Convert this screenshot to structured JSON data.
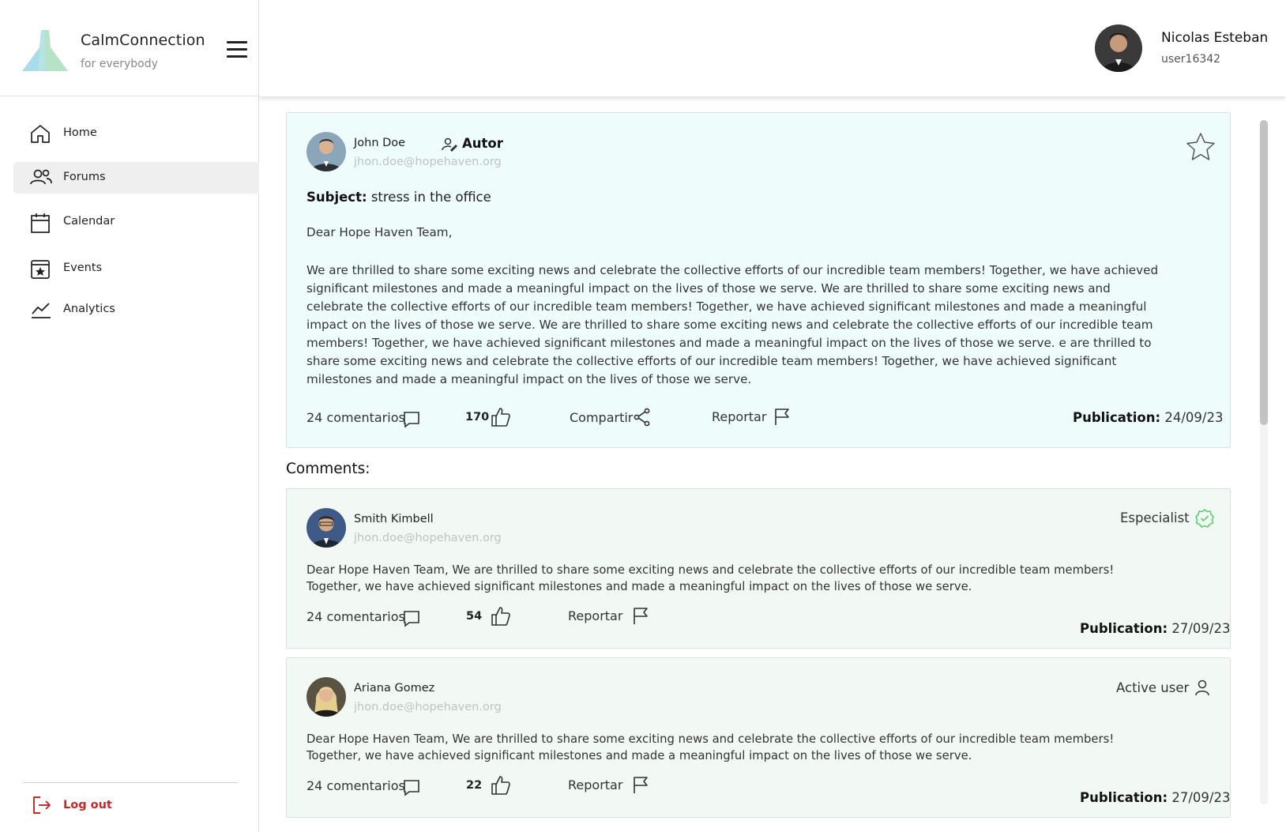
{
  "brand": {
    "name": "CalmConnection",
    "tagline": "for everybody"
  },
  "nav": {
    "items": [
      {
        "label": "Home",
        "icon": "home-icon"
      },
      {
        "label": "Forums",
        "icon": "users-icon",
        "active": true
      },
      {
        "label": "Calendar",
        "icon": "calendar-icon"
      },
      {
        "label": "Events",
        "icon": "star-calendar-icon"
      },
      {
        "label": "Analytics",
        "icon": "trend-line-icon"
      }
    ],
    "logout": "Log out"
  },
  "user": {
    "name": "Nicolas Esteban",
    "handle": "user16342"
  },
  "post": {
    "author": "John Doe",
    "role": "Autor",
    "email": "jhon.doe@hopehaven.org",
    "subject_label": "Subject:",
    "subject": "stress in the office",
    "greeting": "Dear Hope Haven Team,",
    "body": "We are thrilled to share some exciting news and celebrate the collective efforts of our incredible team members! Together, we have achieved significant milestones and made a meaningful impact on the lives of those we serve. We are thrilled to share some exciting news and celebrate the collective efforts of our incredible team members! Together, we have achieved significant milestones and made a meaningful impact on the lives of those we serve. We are thrilled to share some exciting news and celebrate the collective efforts of our incredible team members! Together, we have achieved significant milestones and made a meaningful impact on the lives of those we serve. e are thrilled to share some exciting news and celebrate the collective efforts of our incredible team members! Together, we have achieved significant milestones and made a meaningful impact on the lives of those we serve.",
    "comments": "24 comentarios",
    "likes": "170",
    "share": "Compartir",
    "report": "Reportar",
    "publication_label": "Publication:",
    "publication_date": "24/09/23"
  },
  "comments_title": "Comments:",
  "comments": [
    {
      "author": "Smith Kimbell",
      "email": "jhon.doe@hopehaven.org",
      "badge": "Especialist",
      "badge_icon": "verified-check-icon",
      "body": "Dear Hope Haven Team, We are thrilled to share some exciting news and celebrate the collective efforts of our incredible team members! Together, we have achieved significant milestones and made a meaningful impact on the lives of those we serve.",
      "comments": "24 comentarios",
      "likes": "54",
      "report": "Reportar",
      "publication_label": "Publication:",
      "publication_date": "27/09/23"
    },
    {
      "author": "Ariana Gomez",
      "email": "jhon.doe@hopehaven.org",
      "badge": "Active user",
      "badge_icon": "user-icon",
      "body": "Dear Hope Haven Team, We are thrilled to share some exciting news and celebrate the collective efforts of our incredible team members! Together, we have achieved significant milestones and made a meaningful impact on the lives of those we serve.",
      "comments": "24 comentarios",
      "likes": "22",
      "report": "Reportar",
      "publication_label": "Publication:",
      "publication_date": "27/09/23"
    }
  ],
  "colors": {
    "post_bg": "#eefcfb",
    "comment_bg": "#f2f8f4",
    "logout": "#c62828",
    "verified": "#5ccf6b",
    "active_nav": "#efefef"
  }
}
